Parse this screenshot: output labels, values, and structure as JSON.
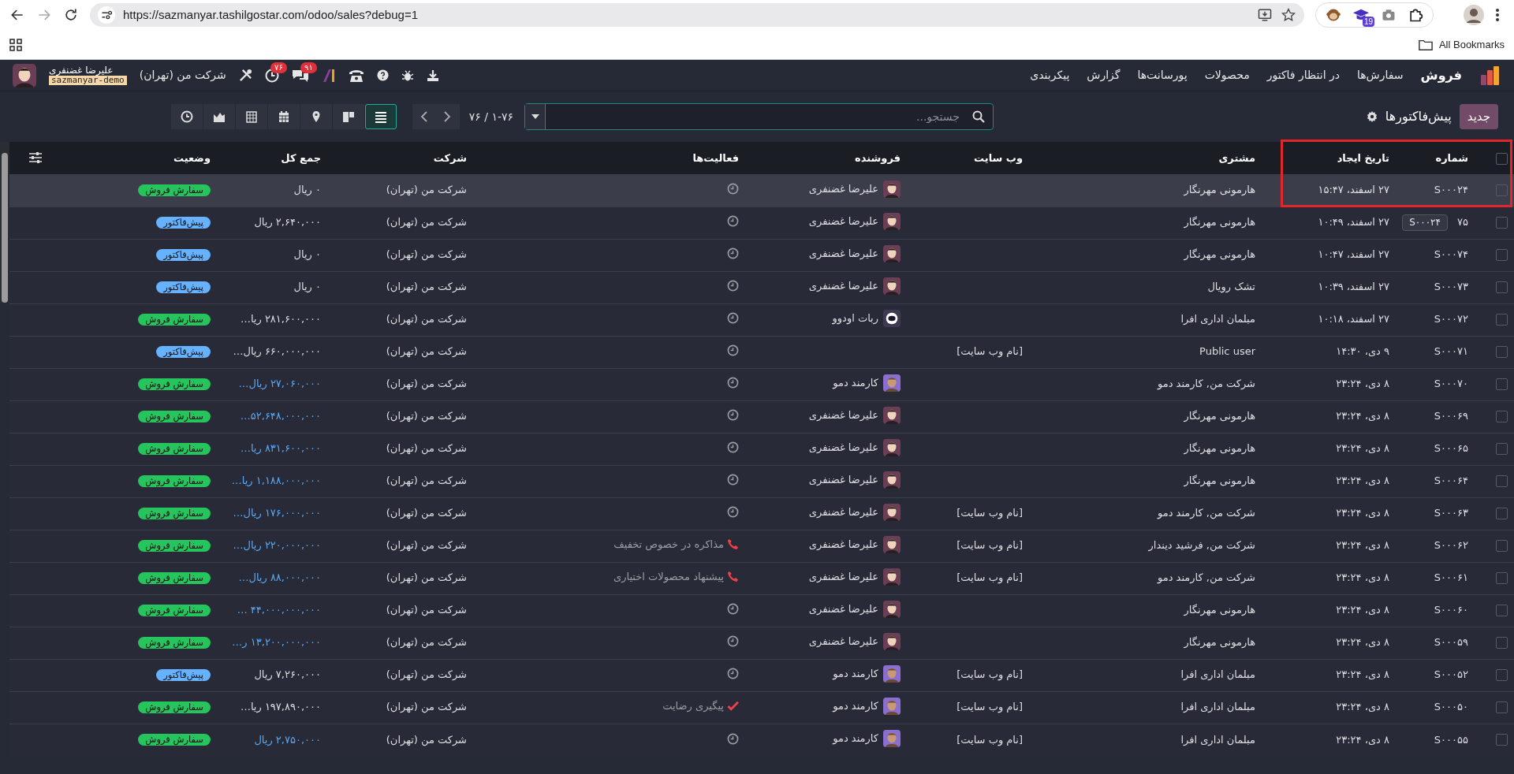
{
  "browser": {
    "url": "https://sazmanyar.tashilgostar.com/odoo/sales?debug=1",
    "extension_badge": "19",
    "bookmarks_label": "All Bookmarks"
  },
  "navbar": {
    "app": "فروش",
    "menu": [
      "سفارش‌ها",
      "در انتظار فاکتور",
      "محصولات",
      "پورسانت‌ها",
      "گزارش",
      "پیکربندی"
    ],
    "company": "شرکت من (تهران)",
    "user": "علیرضا غضنفری",
    "database": "sazmanyar-demo",
    "activity_count": "۷۶",
    "message_count": "۹۱"
  },
  "control_panel": {
    "new_button": "جدید",
    "breadcrumb": "پیش‌فاکتورها",
    "search": {
      "placeholder": "جستجو..."
    },
    "pager": "۱-۷۶ / ۷۶",
    "views": [
      {
        "kind": "list",
        "selected": true
      },
      {
        "kind": "kanban",
        "selected": false
      },
      {
        "kind": "map",
        "selected": false
      },
      {
        "kind": "calendar",
        "selected": false
      },
      {
        "kind": "pivot",
        "selected": false
      },
      {
        "kind": "graph",
        "selected": false
      },
      {
        "kind": "activity",
        "selected": false
      }
    ]
  },
  "table": {
    "header_checked": false,
    "columns": [
      "شماره",
      "تاریخ ایجاد",
      "مشتری",
      "وب سایت",
      "فروشنده",
      "فعالیت‌ها",
      "شرکت",
      "جمع کل",
      "وضعیت"
    ],
    "rows": [
      {
        "number": "S۰۰۰۲۴",
        "created": "۲۷ اسفند، ۱۵:۴۷",
        "customer": "هارمونی مهرنگار",
        "salesperson": {
          "name": "علیرضا غضنفری",
          "kind": "user"
        },
        "activity": {
          "kind": "none"
        },
        "company": "شرکت من (تهران)",
        "total": "۰ ریال",
        "total_emphasis": false,
        "status": {
          "label": "سفارش فروش",
          "kind": "sale"
        },
        "checked": false,
        "hovered": true
      },
      {
        "number": "۷۵",
        "created": "۲۷ اسفند، ۱۰:۴۹",
        "customer": "هارمونی مهرنگار",
        "salesperson": {
          "name": "علیرضا غضنفری",
          "kind": "user"
        },
        "activity": {
          "kind": "none"
        },
        "company": "شرکت من (تهران)",
        "total": "۲,۶۴۰,۰۰۰ ریال",
        "total_emphasis": false,
        "status": {
          "label": "پیش‌فاکتور",
          "kind": "quotation"
        },
        "checked": false,
        "hovered": false,
        "tooltip": "S۰۰۰۲۴"
      },
      {
        "number": "S۰۰۰۷۴",
        "created": "۲۷ اسفند، ۱۰:۴۷",
        "customer": "هارمونی مهرنگار",
        "salesperson": {
          "name": "علیرضا غضنفری",
          "kind": "user"
        },
        "activity": {
          "kind": "none"
        },
        "company": "شرکت من (تهران)",
        "total": "۰ ریال",
        "total_emphasis": false,
        "status": {
          "label": "پیش‌فاکتور",
          "kind": "quotation"
        },
        "checked": false,
        "hovered": false
      },
      {
        "number": "S۰۰۰۷۳",
        "created": "۲۷ اسفند، ۱۰:۳۹",
        "customer": "تشک رویال",
        "salesperson": {
          "name": "علیرضا غضنفری",
          "kind": "user"
        },
        "activity": {
          "kind": "none"
        },
        "company": "شرکت من (تهران)",
        "total": "۰ ریال",
        "total_emphasis": false,
        "status": {
          "label": "پیش‌فاکتور",
          "kind": "quotation"
        },
        "checked": false,
        "hovered": false
      },
      {
        "number": "S۰۰۰۷۲",
        "created": "۲۷ اسفند، ۱۰:۱۸",
        "customer": "مبلمان اداری افرا",
        "salesperson": {
          "name": "ربات اودوو",
          "kind": "bot"
        },
        "activity": {
          "kind": "none"
        },
        "company": "شرکت من (تهران)",
        "total": "۲۸۱,۶۰۰,۰۰۰ ریا…",
        "total_emphasis": false,
        "status": {
          "label": "سفارش فروش",
          "kind": "sale"
        },
        "checked": false,
        "hovered": false
      },
      {
        "number": "S۰۰۰۷۱",
        "created": "۹ دی، ۱۴:۳۰",
        "customer": "Public user",
        "website": "[نام وب سایت]",
        "activity": {
          "kind": "none"
        },
        "company": "شرکت من (تهران)",
        "total": "۶۶۰,۰۰۰,۰۰۰ ریال…",
        "total_emphasis": false,
        "status": {
          "label": "پیش‌فاکتور",
          "kind": "quotation"
        },
        "checked": false,
        "hovered": false
      },
      {
        "number": "S۰۰۰۷۰",
        "created": "۸ دی، ۲۳:۲۴",
        "customer": "شرکت من, کارمند دمو",
        "salesperson": {
          "name": "کارمند دمو",
          "kind": "employee"
        },
        "activity": {
          "kind": "none"
        },
        "company": "شرکت من (تهران)",
        "total": "۲۷,۰۶۰,۰۰۰ ریال…",
        "total_emphasis": true,
        "status": {
          "label": "سفارش فروش",
          "kind": "sale"
        },
        "checked": false,
        "hovered": false
      },
      {
        "number": "S۰۰۰۶۹",
        "created": "۸ دی، ۲۳:۲۴",
        "customer": "هارمونی مهرنگار",
        "salesperson": {
          "name": "علیرضا غضنفری",
          "kind": "user"
        },
        "activity": {
          "kind": "none"
        },
        "company": "شرکت من (تهران)",
        "total": "۵۲,۶۴۸,۰۰۰,۰۰۰…",
        "total_emphasis": true,
        "status": {
          "label": "سفارش فروش",
          "kind": "sale"
        },
        "checked": false,
        "hovered": false
      },
      {
        "number": "S۰۰۰۶۵",
        "created": "۸ دی، ۲۳:۲۴",
        "customer": "هارمونی مهرنگار",
        "salesperson": {
          "name": "علیرضا غضنفری",
          "kind": "user"
        },
        "activity": {
          "kind": "none"
        },
        "company": "شرکت من (تهران)",
        "total": "۸۳۱,۶۰۰,۰۰۰ ریا…",
        "total_emphasis": true,
        "status": {
          "label": "سفارش فروش",
          "kind": "sale"
        },
        "checked": false,
        "hovered": false
      },
      {
        "number": "S۰۰۰۶۴",
        "created": "۸ دی، ۲۳:۲۴",
        "customer": "هارمونی مهرنگار",
        "salesperson": {
          "name": "علیرضا غضنفری",
          "kind": "user"
        },
        "activity": {
          "kind": "none"
        },
        "company": "شرکت من (تهران)",
        "total": "۱,۱۸۸,۰۰۰,۰۰۰ ریا…",
        "total_emphasis": true,
        "status": {
          "label": "سفارش فروش",
          "kind": "sale"
        },
        "checked": false,
        "hovered": false
      },
      {
        "number": "S۰۰۰۶۳",
        "created": "۸ دی، ۲۳:۲۴",
        "customer": "شرکت من, کارمند دمو",
        "website": "[نام وب سایت]",
        "salesperson": {
          "name": "علیرضا غضنفری",
          "kind": "user"
        },
        "activity": {
          "kind": "none"
        },
        "company": "شرکت من (تهران)",
        "total": "۱۷۶,۰۰۰,۰۰۰ ریال…",
        "total_emphasis": true,
        "status": {
          "label": "سفارش فروش",
          "kind": "sale"
        },
        "checked": false,
        "hovered": false
      },
      {
        "number": "S۰۰۰۶۲",
        "created": "۸ دی، ۲۳:۲۴",
        "customer": "شرکت من, فرشید دیندار",
        "website": "[نام وب سایت]",
        "salesperson": {
          "name": "علیرضا غضنفری",
          "kind": "user"
        },
        "activity": {
          "kind": "call",
          "summary": "مذاکره در خصوص تخفیف"
        },
        "company": "شرکت من (تهران)",
        "total": "۲۲۰,۰۰۰,۰۰۰ ریال…",
        "total_emphasis": true,
        "status": {
          "label": "سفارش فروش",
          "kind": "sale"
        },
        "checked": false,
        "hovered": false
      },
      {
        "number": "S۰۰۰۶۱",
        "created": "۸ دی، ۲۳:۲۴",
        "customer": "شرکت من, کارمند دمو",
        "website": "[نام وب سایت]",
        "salesperson": {
          "name": "علیرضا غضنفری",
          "kind": "user"
        },
        "activity": {
          "kind": "call",
          "summary": "پیشنهاد محصولات اختیاری"
        },
        "company": "شرکت من (تهران)",
        "total": "۸۸,۰۰۰,۰۰۰ ریال…",
        "total_emphasis": true,
        "status": {
          "label": "سفارش فروش",
          "kind": "sale"
        },
        "checked": false,
        "hovered": false
      },
      {
        "number": "S۰۰۰۶۰",
        "created": "۸ دی، ۲۳:۲۴",
        "customer": "هارمونی مهرنگار",
        "salesperson": {
          "name": "علیرضا غضنفری",
          "kind": "user"
        },
        "activity": {
          "kind": "none"
        },
        "company": "شرکت من (تهران)",
        "total": "۴۴,۰۰۰,۰۰۰,۰۰۰ …",
        "total_emphasis": true,
        "status": {
          "label": "سفارش فروش",
          "kind": "sale"
        },
        "checked": false,
        "hovered": false
      },
      {
        "number": "S۰۰۰۵۹",
        "created": "۸ دی، ۲۳:۲۴",
        "customer": "هارمونی مهرنگار",
        "salesperson": {
          "name": "علیرضا غضنفری",
          "kind": "user"
        },
        "activity": {
          "kind": "none"
        },
        "company": "شرکت من (تهران)",
        "total": "۱۳,۲۰۰,۰۰۰,۰۰۰ ر…",
        "total_emphasis": true,
        "status": {
          "label": "سفارش فروش",
          "kind": "sale"
        },
        "checked": false,
        "hovered": false
      },
      {
        "number": "S۰۰۰۵۲",
        "created": "۸ دی، ۲۳:۲۴",
        "customer": "مبلمان اداری افرا",
        "website": "[نام وب سایت]",
        "salesperson": {
          "name": "کارمند دمو",
          "kind": "employee"
        },
        "activity": {
          "kind": "none"
        },
        "company": "شرکت من (تهران)",
        "total": "۷,۲۶۰,۰۰۰ ریال",
        "total_emphasis": false,
        "status": {
          "label": "پیش‌فاکتور",
          "kind": "quotation"
        },
        "checked": false,
        "hovered": false
      },
      {
        "number": "S۰۰۰۵۰",
        "created": "۸ دی، ۲۳:۲۴",
        "customer": "مبلمان اداری افرا",
        "website": "[نام وب سایت]",
        "salesperson": {
          "name": "کارمند دمو",
          "kind": "employee"
        },
        "activity": {
          "kind": "todo",
          "summary": "پیگیری رضایت"
        },
        "company": "شرکت من (تهران)",
        "total": "۱۹۷,۸۹۰,۰۰۰ ریا…",
        "total_emphasis": false,
        "status": {
          "label": "سفارش فروش",
          "kind": "sale"
        },
        "checked": false,
        "hovered": false
      },
      {
        "number": "S۰۰۰۵۵",
        "created": "۸ دی، ۲۳:۲۴",
        "customer": "مبلمان اداری افرا",
        "website": "[نام وب سایت]",
        "salesperson": {
          "name": "کارمند دمو",
          "kind": "employee"
        },
        "activity": {
          "kind": "none"
        },
        "company": "شرکت من (تهران)",
        "total": "۲,۷۵۰,۰۰۰ ریال",
        "total_emphasis": true,
        "status": {
          "label": "سفارش فروش",
          "kind": "sale"
        },
        "checked": false,
        "hovered": false
      }
    ]
  }
}
